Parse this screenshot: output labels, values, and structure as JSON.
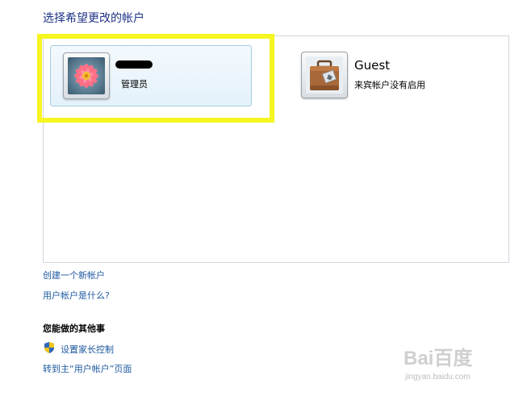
{
  "page": {
    "title": "选择希望更改的帐户"
  },
  "accounts": [
    {
      "name": "",
      "role": "管理员",
      "avatar": "flower-avatar",
      "selected": true
    },
    {
      "name": "Guest",
      "role": "来宾帐户没有启用",
      "avatar": "suitcase-avatar",
      "selected": false
    }
  ],
  "links": {
    "create_account": "创建一个新帐户",
    "what_is_account": "用户帐户是什么?"
  },
  "other_tasks": {
    "heading": "您能做的其他事",
    "parental_controls": "设置家长控制",
    "go_main_page": "转到主“用户帐户”页面"
  },
  "watermark": {
    "main": "Bai百度",
    "sub": "jingyan.baidu.com"
  },
  "colors": {
    "title": "#1e3287",
    "link": "#1e5aa0",
    "highlight": "#f5f520"
  }
}
